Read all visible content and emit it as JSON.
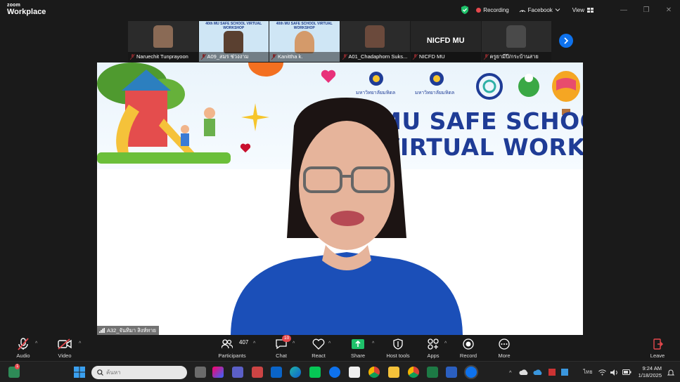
{
  "app": {
    "brand_small": "zoom",
    "brand_large": "Workplace"
  },
  "titlebar": {
    "recording": "Recording",
    "facebook": "Facebook",
    "view": "View"
  },
  "thumbnails": [
    {
      "name": "Naruechit Tunprayoon",
      "muted": true,
      "kind": "person",
      "color": "#8a6a55"
    },
    {
      "name": "A09_สมร ช่วงงาม",
      "muted": true,
      "kind": "poster",
      "poster_text": "40th MU SAFE SCHOOL VIRTUAL WORKSHOP"
    },
    {
      "name": "Kanittha k.",
      "muted": true,
      "kind": "poster",
      "poster_text": "40th MU SAFE SCHOOL VIRTUAL WORKSHOP"
    },
    {
      "name": "A01_Chadaphorn Suks...",
      "muted": true,
      "kind": "person",
      "color": "#6b4a3c"
    },
    {
      "name": "NICFD MU",
      "muted": true,
      "kind": "text",
      "big_text": "NICFD MU"
    },
    {
      "name": "ครูยามีปี/กระบ้านสาย",
      "muted": true,
      "kind": "person",
      "color": "#3a3a3a"
    }
  ],
  "stage": {
    "banner_line1": "MU SAFE SCHOOL",
    "banner_line2": "VIRTUAL WORKSHOP",
    "logo1": "มหาวิทยาลัยมหิดล",
    "logo2": "มหาวิทยาลัยมหิดล",
    "speaker_name": "A32_จันทิมา สิงห์ทาย"
  },
  "toolbar": {
    "audio": "Audio",
    "video": "Video",
    "participants": "Participants",
    "participants_count": "407",
    "chat": "Chat",
    "chat_badge": "10",
    "react": "React",
    "share": "Share",
    "host_tools": "Host tools",
    "apps": "Apps",
    "record": "Record",
    "more": "More",
    "leave": "Leave"
  },
  "taskbar": {
    "search_placeholder": "ค้นหา",
    "notify_badge": "1",
    "language": "ไทย",
    "time": "9:24 AM",
    "date": "1/18/2025"
  },
  "colors": {
    "accent": "#0e72ed",
    "share_green": "#1ec26a",
    "alert_red": "#e5484d",
    "banner_blue": "#1f3c96"
  }
}
